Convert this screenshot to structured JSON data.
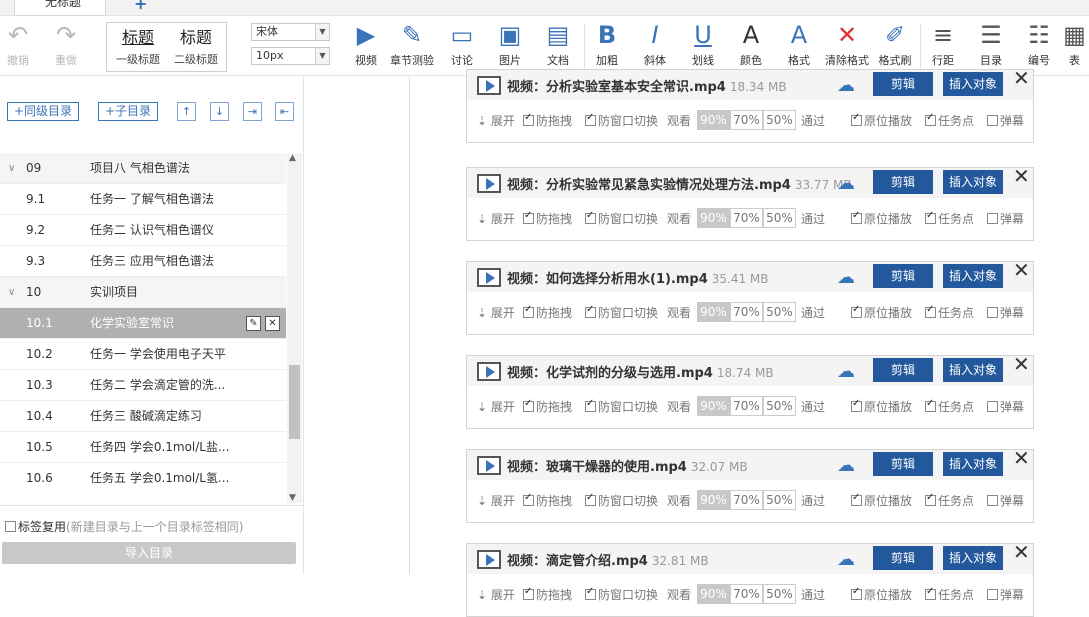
{
  "tabs": {
    "active_label": "无标题"
  },
  "toolbar": {
    "undo": "撤销",
    "redo": "重做",
    "style1_big": "标题",
    "style1_small": "一级标题",
    "style2_big": "标题",
    "style2_small": "二级标题",
    "font_family": "宋体",
    "font_size": "10px",
    "video": "视频",
    "chapter_quiz": "章节测验",
    "discussion": "讨论",
    "image": "图片",
    "document": "文档",
    "bold": "加粗",
    "italic": "斜体",
    "underline": "划线",
    "color": "颜色",
    "format": "格式",
    "clear_format": "清除格式",
    "format_painter": "格式刷",
    "line_spacing": "行距",
    "toc": "目录",
    "numbering": "编号",
    "table": "表"
  },
  "left_panel": {
    "add_sibling": "+同级目录",
    "add_child": "+子目录",
    "tree": [
      {
        "num": "09",
        "title": "项目八 气相色谱法",
        "group": true,
        "selected": false
      },
      {
        "num": "9.1",
        "title": "任务一 了解气相色谱法",
        "group": false,
        "selected": false
      },
      {
        "num": "9.2",
        "title": "任务二 认识气相色谱仪",
        "group": false,
        "selected": false
      },
      {
        "num": "9.3",
        "title": "任务三 应用气相色谱法",
        "group": false,
        "selected": false
      },
      {
        "num": "10",
        "title": "实训项目",
        "group": true,
        "selected": false
      },
      {
        "num": "10.1",
        "title": "化学实验室常识",
        "group": false,
        "selected": true
      },
      {
        "num": "10.2",
        "title": "任务一 学会使用电子天平",
        "group": false,
        "selected": false
      },
      {
        "num": "10.3",
        "title": "任务二 学会滴定管的洗...",
        "group": false,
        "selected": false
      },
      {
        "num": "10.4",
        "title": "任务三 酸碱滴定练习",
        "group": false,
        "selected": false
      },
      {
        "num": "10.5",
        "title": "任务四 学会0.1mol/L盐...",
        "group": false,
        "selected": false
      },
      {
        "num": "10.6",
        "title": "任务五 学会0.1mol/L氢...",
        "group": false,
        "selected": false
      }
    ],
    "reuse_label": "标签复用",
    "reuse_hint": "(新建目录与上一个目录标签相同)",
    "import_button": "导入目录"
  },
  "cards": [
    {
      "title": "视频：分析实验室基本安全常识.mp4",
      "size": "18.34 MB"
    },
    {
      "title": "视频：分析实验常见紧急实验情况处理方法.mp4",
      "size": "33.77 MB"
    },
    {
      "title": "视频：如何选择分析用水(1).mp4",
      "size": "35.41 MB"
    },
    {
      "title": "视频：化学试剂的分级与选用.mp4",
      "size": "18.74 MB"
    },
    {
      "title": "视频：玻璃干燥器的使用.mp4",
      "size": "32.07 MB"
    },
    {
      "title": "视频：滴定管介绍.mp4",
      "size": "32.81 MB"
    }
  ],
  "card_labels": {
    "edit": "剪辑",
    "insert": "插入对象",
    "expand": "展开",
    "anti_drag": "防拖拽",
    "anti_switch": "防窗口切换",
    "watch": "观看",
    "pct90": "90%",
    "pct70": "70%",
    "pct50": "50%",
    "pass": "通过",
    "original_play": "原位播放",
    "task_point": "任务点",
    "bullet": "弹幕"
  }
}
